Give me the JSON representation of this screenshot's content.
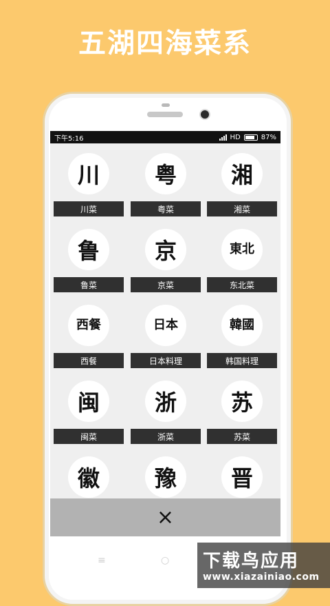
{
  "headline": "五湖四海菜系",
  "status_bar": {
    "time": "下午5:16",
    "network": "HD",
    "battery": "87%"
  },
  "cuisines": [
    {
      "glyph": "川",
      "label": "川菜"
    },
    {
      "glyph": "粤",
      "label": "粤菜"
    },
    {
      "glyph": "湘",
      "label": "湘菜"
    },
    {
      "glyph": "鲁",
      "label": "鲁菜"
    },
    {
      "glyph": "京",
      "label": "京菜"
    },
    {
      "glyph": "東北",
      "label": "东北菜"
    },
    {
      "glyph": "西餐",
      "label": "西餐"
    },
    {
      "glyph": "日本",
      "label": "日本料理"
    },
    {
      "glyph": "韓國",
      "label": "韩国料理"
    },
    {
      "glyph": "闽",
      "label": "闽菜"
    },
    {
      "glyph": "浙",
      "label": "浙菜"
    },
    {
      "glyph": "苏",
      "label": "苏菜"
    },
    {
      "glyph": "徽",
      "label": ""
    },
    {
      "glyph": "豫",
      "label": ""
    },
    {
      "glyph": "晋",
      "label": ""
    }
  ],
  "close_glyph": "×",
  "nav": {
    "menu": "≡",
    "home": "○",
    "back": "‹"
  },
  "watermark": {
    "title": "下载鸟应用",
    "url": "www.xiazainiao.com"
  },
  "colors": {
    "background": "#fcc96d",
    "label_bg": "#303030",
    "close_bar": "#b2b2b2"
  }
}
